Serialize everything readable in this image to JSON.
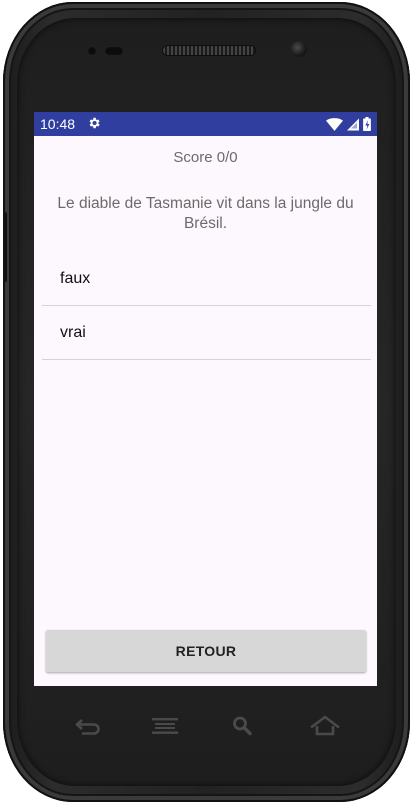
{
  "status_bar": {
    "time": "10:48",
    "settings_icon": "gear-icon",
    "wifi_icon": "wifi-icon",
    "signal_icon": "signal-icon",
    "battery_icon": "battery-icon",
    "color": "#303f9f"
  },
  "quiz": {
    "score": "Score 0/0",
    "question": "Le diable de Tasmanie vit dans la jungle du Brésil.",
    "answers": [
      {
        "label": "faux"
      },
      {
        "label": "vrai"
      }
    ],
    "back_label": "RETOUR"
  },
  "nav_bar": {
    "keys": [
      "back-icon",
      "menu-icon",
      "search-icon",
      "home-icon"
    ]
  },
  "colors": {
    "screen_background": "#fdf8fd",
    "button_background": "#d8d7d8"
  }
}
